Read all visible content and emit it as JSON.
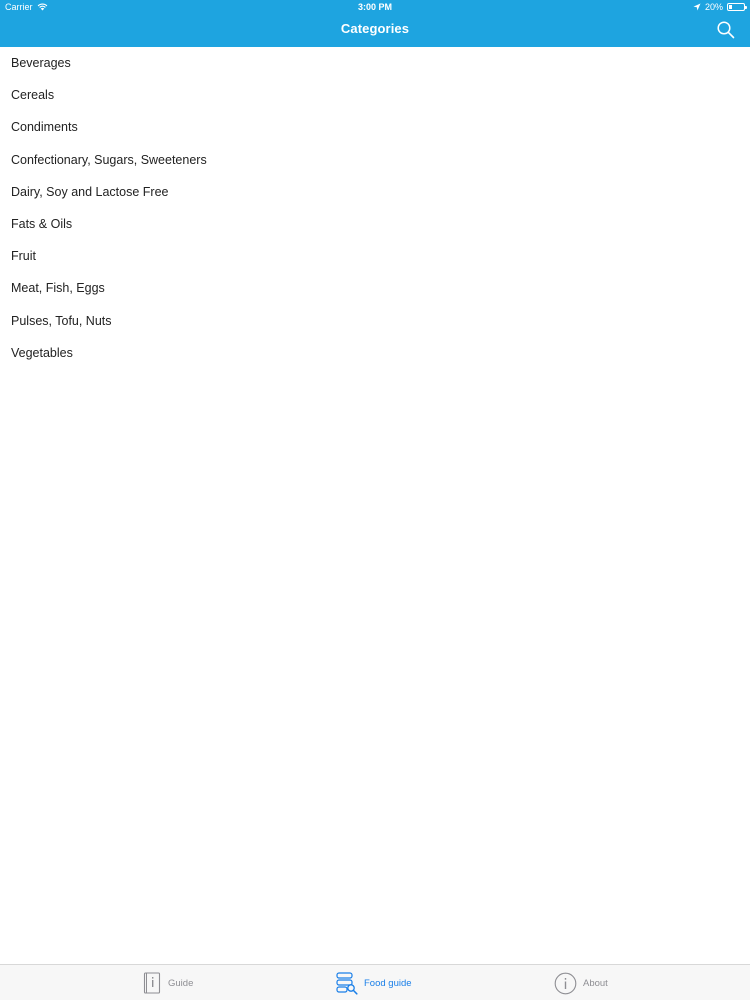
{
  "status_bar": {
    "carrier": "Carrier",
    "time": "3:00 PM",
    "battery": "20%",
    "battery_level": 0.2
  },
  "nav": {
    "title": "Categories",
    "search_icon": "search-icon"
  },
  "categories": [
    "Beverages",
    "Cereals",
    "Condiments",
    "Confectionary, Sugars, Sweeteners",
    "Dairy, Soy and Lactose Free",
    "Fats & Oils",
    "Fruit",
    "Meat, Fish, Eggs",
    "Pulses, Tofu, Nuts",
    "Vegetables"
  ],
  "tabs": [
    {
      "label": "Guide",
      "icon": "book-info-icon",
      "active": false
    },
    {
      "label": "Food guide",
      "icon": "database-search-icon",
      "active": true
    },
    {
      "label": "About",
      "icon": "info-circle-icon",
      "active": false
    }
  ],
  "colors": {
    "nav_background": "#1ea4e0",
    "tab_active": "#1a7fe8",
    "tab_inactive": "#8e8e93"
  }
}
